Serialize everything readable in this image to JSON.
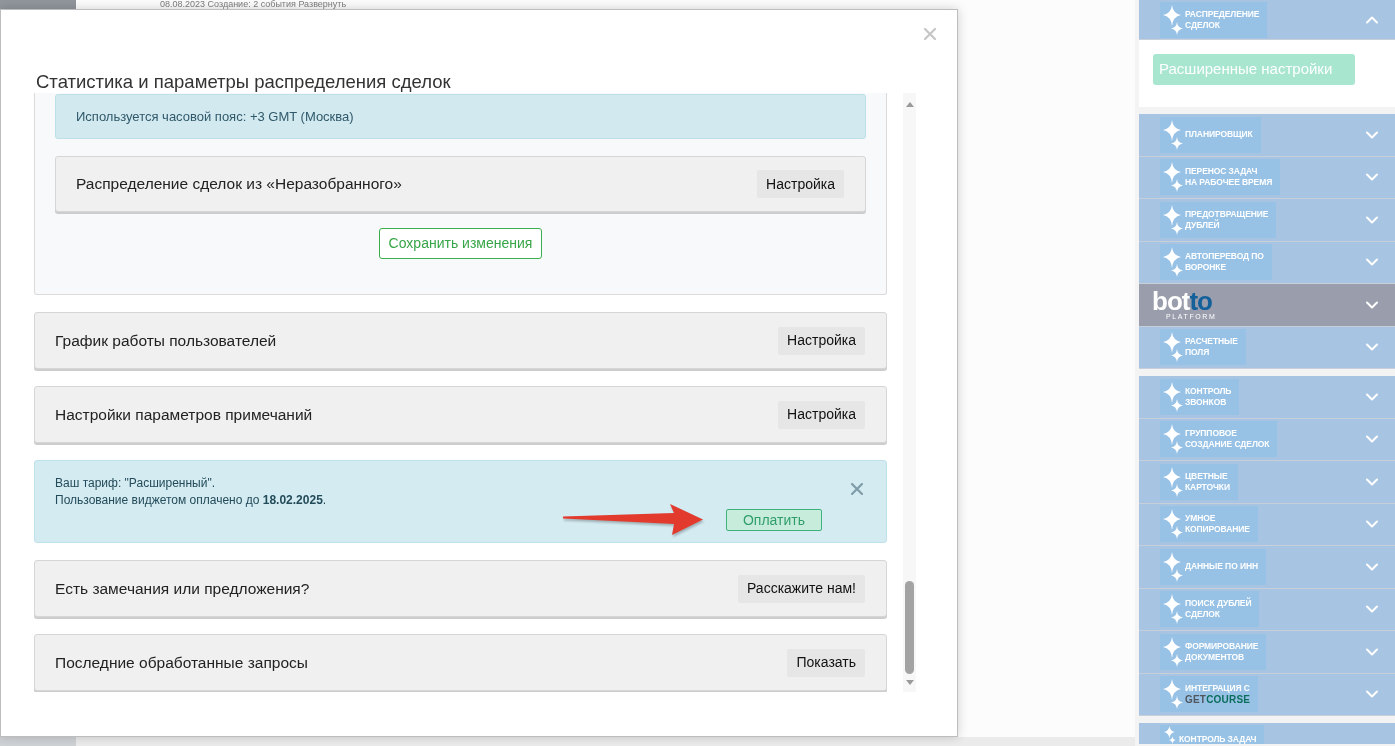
{
  "backdrop": {
    "text": "08.08.2023 Создание: 2 события Развернуть"
  },
  "modal": {
    "title": "Статистика и параметры распределения сделок",
    "settings_panel": {
      "timezone_notice": "Используется часовой пояс: +3 GMT (Москва)",
      "rows": [
        {
          "label": "Распределение сделок из «Неразобранного»",
          "button": "Настройка"
        }
      ],
      "save_button": "Сохранить изменения"
    },
    "sections": [
      {
        "kind": "row",
        "label": "График работы пользователей",
        "button": "Настройка"
      },
      {
        "kind": "row",
        "label": "Настройки параметров примечаний",
        "button": "Настройка"
      },
      {
        "kind": "notice",
        "lines": [
          "Ваш тариф: \"Расширенный\".",
          "Пользование виджетом оплачено до **18.02.2025**."
        ],
        "button": "Оплатить",
        "pointer_arrow": true
      },
      {
        "kind": "row",
        "label": "Есть замечания или предложения?",
        "button": "Расскажите нам!"
      },
      {
        "kind": "row",
        "label": "Последние обработанные запросы",
        "button": "Показать"
      }
    ]
  },
  "widget_panel": {
    "groups": [
      {
        "items": [
          {
            "kind": "tile",
            "lines": [
              "РАСПРЕДЕЛЕНИЕ",
              "СДЕЛОК"
            ],
            "expanded": true,
            "settings_button": "Расширенные настройки"
          }
        ]
      },
      {
        "items": [
          {
            "kind": "tile",
            "lines": [
              "ПЛАНИРОВЩИК"
            ],
            "expanded": false
          },
          {
            "kind": "tile",
            "lines": [
              "ПЕРЕНОС ЗАДАЧ",
              "НА РАБОЧЕЕ ВРЕМЯ"
            ],
            "expanded": false
          },
          {
            "kind": "tile",
            "lines": [
              "ПРЕДОТВРАЩЕНИЕ",
              "ДУБЛЕЙ"
            ],
            "expanded": false
          },
          {
            "kind": "tile",
            "lines": [
              "АВТОПЕРЕВОД ПО",
              "ВОРОНКЕ"
            ],
            "expanded": false
          },
          {
            "kind": "brand",
            "name_start": "bot",
            "name_end": "to",
            "tagline": "PLATFORM",
            "expanded": false
          },
          {
            "kind": "tile",
            "lines": [
              "РАСЧЕТНЫЕ",
              "ПОЛЯ"
            ],
            "expanded": false
          }
        ]
      },
      {
        "items": [
          {
            "kind": "tile",
            "lines": [
              "КОНТРОЛЬ",
              "ЗВОНКОВ"
            ],
            "expanded": false
          },
          {
            "kind": "tile",
            "lines": [
              "ГРУППОВОЕ",
              "СОЗДАНИЕ СДЕЛОК"
            ],
            "expanded": false
          },
          {
            "kind": "tile",
            "lines": [
              "ЦВЕТНЫЕ",
              "КАРТОЧКИ"
            ],
            "expanded": false
          },
          {
            "kind": "tile",
            "lines": [
              "УМНОЕ",
              "КОПИРОВАНИЕ"
            ],
            "expanded": false
          },
          {
            "kind": "tile",
            "lines": [
              "ДАННЫЕ ПО ИНН"
            ],
            "expanded": false
          },
          {
            "kind": "tile",
            "lines": [
              "ПОИСК ДУБЛЕЙ",
              "СДЕЛОК"
            ],
            "expanded": false
          },
          {
            "kind": "tile",
            "lines": [
              "ФОРМИРОВАНИЕ",
              "ДОКУМЕНТОВ"
            ],
            "expanded": false
          },
          {
            "kind": "partner",
            "lines": [
              "ИНТЕГРАЦИЯ С"
            ],
            "partner_start": "GET",
            "partner_end": "COURSE",
            "expanded": false
          }
        ]
      },
      {
        "items": [
          {
            "kind": "tile",
            "lines": [
              "КОНТРОЛЬ ЗАДАЧ"
            ]
          }
        ]
      }
    ]
  }
}
